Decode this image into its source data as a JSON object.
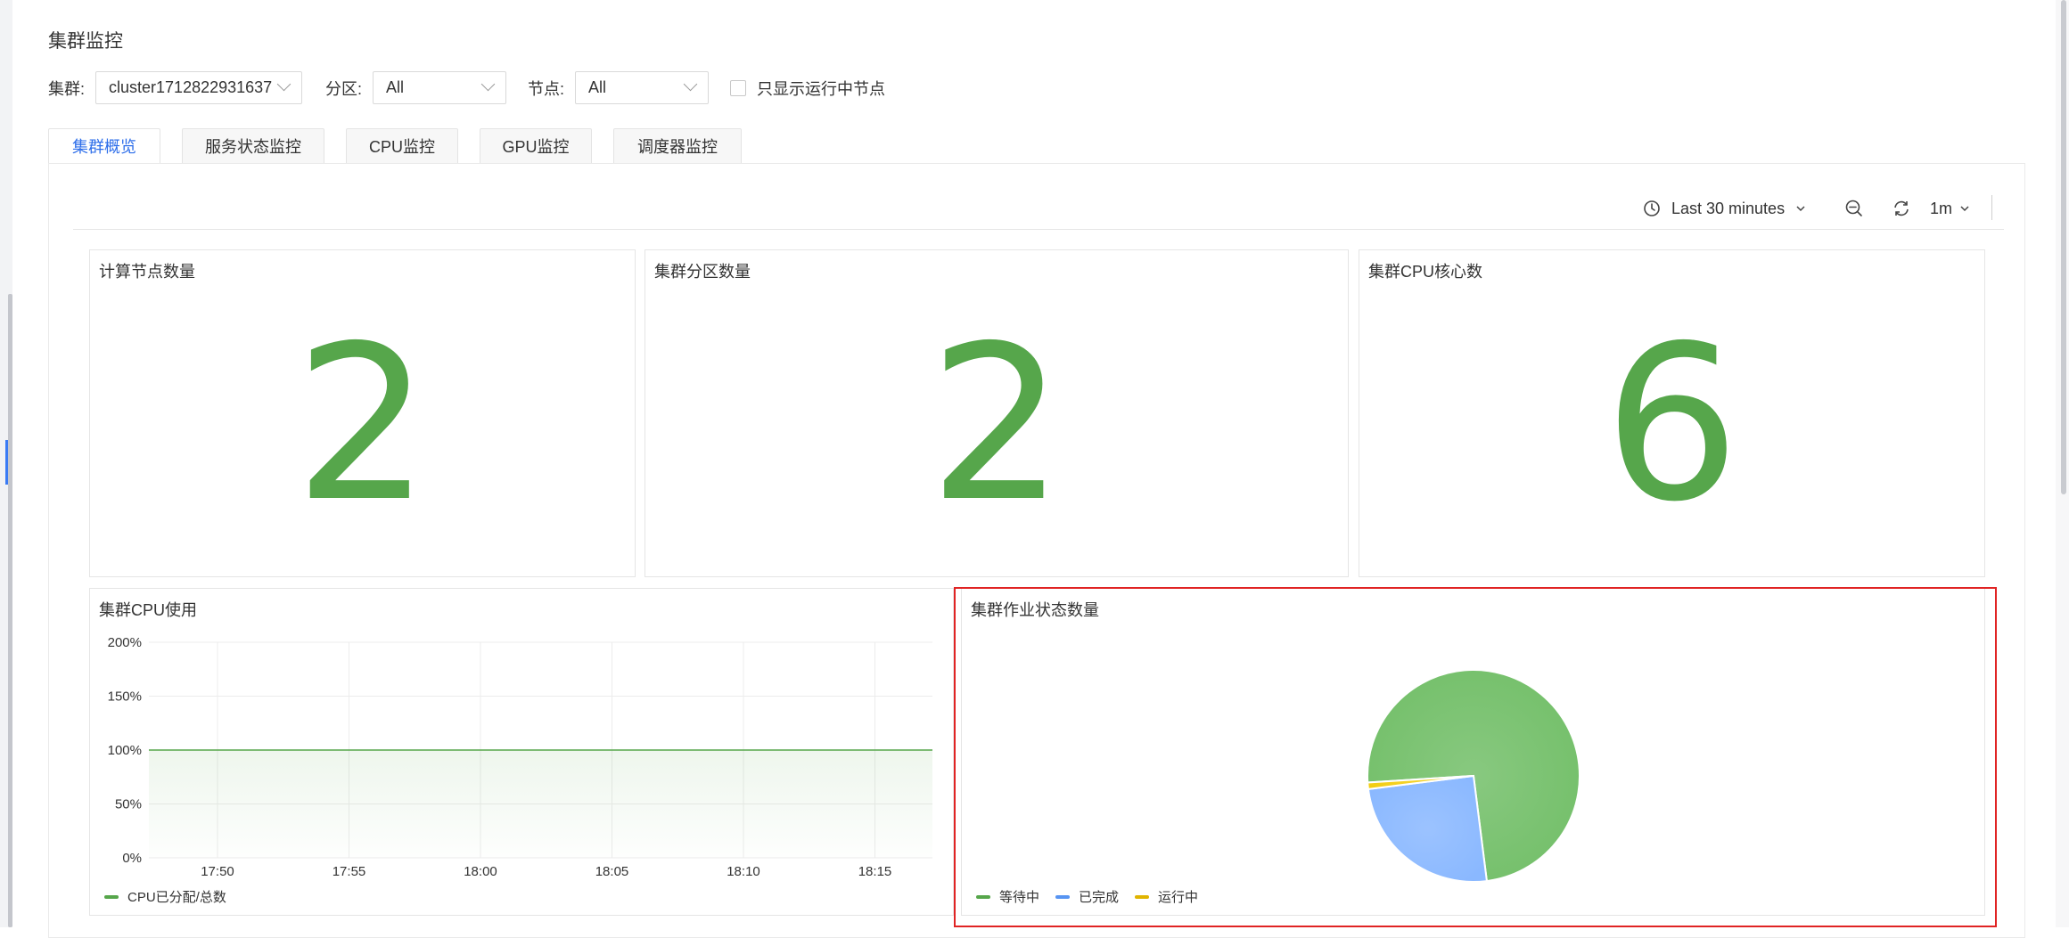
{
  "page": {
    "title": "集群监控"
  },
  "filters": {
    "cluster": {
      "label": "集群:",
      "value": "cluster1712822931637"
    },
    "partition": {
      "label": "分区:",
      "value": "All"
    },
    "node": {
      "label": "节点:",
      "value": "All"
    },
    "running_only": {
      "label": "只显示运行中节点",
      "checked": false
    }
  },
  "tabs": [
    {
      "label": "集群概览",
      "active": true
    },
    {
      "label": "服务状态监控",
      "active": false
    },
    {
      "label": "CPU监控",
      "active": false
    },
    {
      "label": "GPU监控",
      "active": false
    },
    {
      "label": "调度器监控",
      "active": false
    }
  ],
  "toolbar": {
    "time_range": "Last 30 minutes",
    "refresh_interval": "1m",
    "icons": [
      "clock-icon",
      "zoom-out-icon",
      "refresh-icon"
    ]
  },
  "stats": [
    {
      "title": "计算节点数量",
      "value": "2"
    },
    {
      "title": "集群分区数量",
      "value": "2"
    },
    {
      "title": "集群CPU核心数",
      "value": "6"
    }
  ],
  "colors": {
    "green": "#56a64b",
    "blue": "#5794f2",
    "yellow": "#e0b400",
    "tab_active": "#2f6fea",
    "highlight": "#e02424"
  },
  "cpu_panel": {
    "title": "集群CPU使用",
    "chart_data": {
      "type": "area",
      "x": [
        "17:50",
        "17:55",
        "18:00",
        "18:05",
        "18:10",
        "18:15"
      ],
      "y_ticks": [
        "200%",
        "150%",
        "100%",
        "50%",
        "0%"
      ],
      "ylim": [
        0,
        200
      ],
      "series": [
        {
          "name": "CPU已分配/总数",
          "values": [
            100,
            100,
            100,
            100,
            100,
            100
          ],
          "color": "#56a64b"
        }
      ],
      "grid": true,
      "legend": "bottom-left"
    }
  },
  "job_panel": {
    "title": "集群作业状态数量",
    "chart_data": {
      "type": "pie",
      "slices": [
        {
          "name": "等待中",
          "value": 74,
          "color": "#73bf69"
        },
        {
          "name": "已完成",
          "value": 25,
          "color": "#8ab8ff"
        },
        {
          "name": "运行中",
          "value": 1,
          "color": "#f2cc0c"
        }
      ],
      "legend": "bottom-left"
    }
  }
}
